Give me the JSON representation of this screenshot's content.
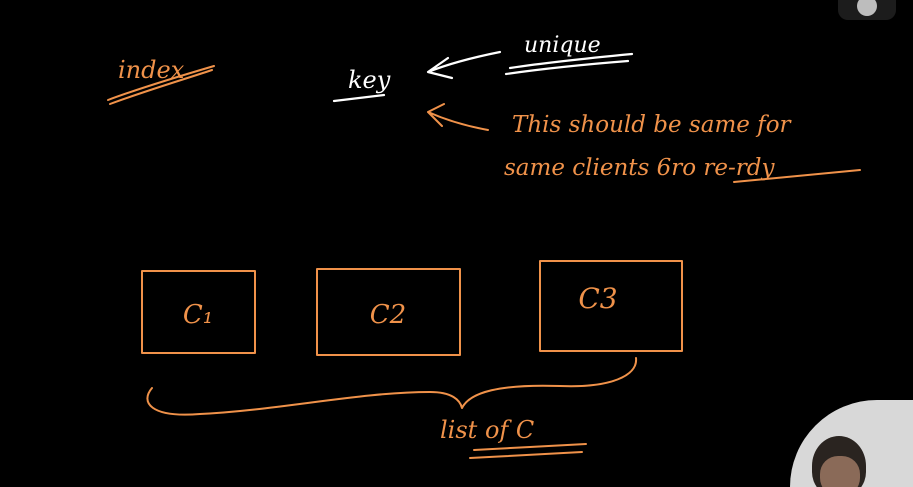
{
  "labels": {
    "index": "index",
    "key": "key",
    "unique": "unique",
    "note_line1": "This should be same for",
    "note_line2": "same clients 6ro re-rdy",
    "list": "list of C"
  },
  "boxes": [
    {
      "label": "C₁"
    },
    {
      "label": "C2"
    },
    {
      "label": "C3"
    }
  ],
  "colors": {
    "background": "#000000",
    "accent": "#f0924a",
    "ink": "#ffffff"
  },
  "icons": {
    "top_control": "record-indicator-icon",
    "webcam": "webcam-overlay"
  }
}
